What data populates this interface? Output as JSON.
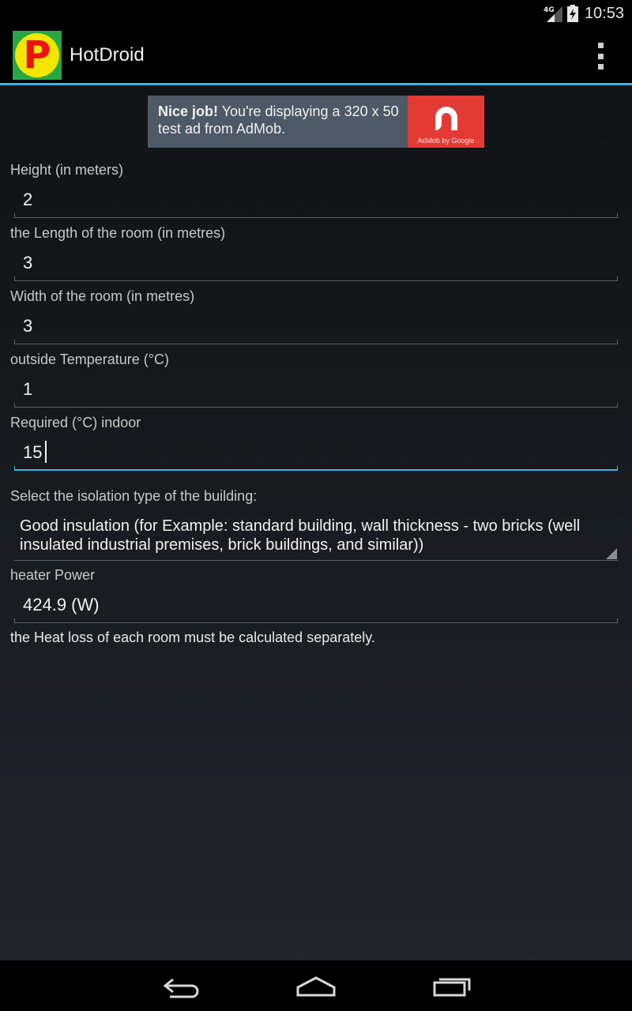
{
  "status_bar": {
    "network": "4G",
    "time": "10:53",
    "icons": [
      "signal-icon",
      "battery-charging-icon"
    ]
  },
  "action_bar": {
    "app_name": "HotDroid",
    "logo_letter": "P",
    "menu_icon": "overflow-menu-icon"
  },
  "ad": {
    "bold": "Nice job!",
    "text": " You're displaying a 320 x 50 test ad from AdMob.",
    "byline": "AdMob by Google"
  },
  "form": {
    "height_label": "Height (in meters)",
    "height_value": "2",
    "length_label": "the Length of the room (in metres)",
    "length_value": "3",
    "width_label": "Width of the room (in metres)",
    "width_value": "3",
    "outside_temp_label": "outside Temperature (°C)",
    "outside_temp_value": "1",
    "required_temp_label": "Required (°C) indoor",
    "required_temp_value": "15",
    "isolation_label": "Select the isolation type of the building:",
    "isolation_value": "Good insulation (for Example: standard building, wall thickness - two bricks (well insulated industrial premises, brick buildings, and similar))",
    "power_label": "heater Power",
    "power_value": "424.9 (W)",
    "note": "the Heat loss of each room must be calculated separately."
  },
  "nav_bar": {
    "icons": [
      "back-icon",
      "home-icon",
      "recent-apps-icon"
    ]
  },
  "colors": {
    "accent": "#33b5e5",
    "ad_red": "#e33b34",
    "logo_green": "#27a844",
    "logo_yellow": "#f2e600"
  }
}
